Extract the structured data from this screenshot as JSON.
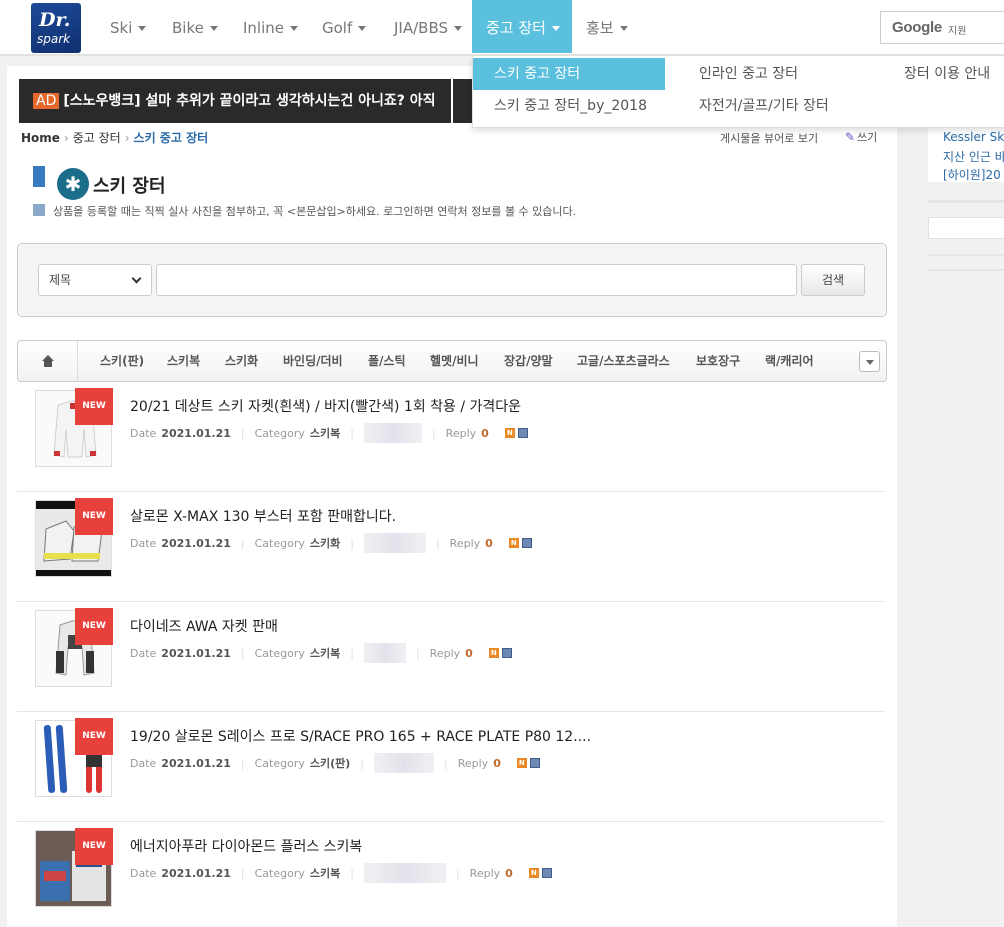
{
  "logo": {
    "line1": "Dr.",
    "line2": "spark"
  },
  "nav": [
    {
      "label": "Ski",
      "active": false
    },
    {
      "label": "Bike",
      "active": false
    },
    {
      "label": "Inline",
      "active": false
    },
    {
      "label": "Golf",
      "active": false
    },
    {
      "label": "JIA/BBS",
      "active": false
    },
    {
      "label": "중고 장터",
      "active": true
    },
    {
      "label": "홍보",
      "active": false
    }
  ],
  "google_search": {
    "brand": "Google",
    "suffix": "지원"
  },
  "dropdown": [
    {
      "label": "스키 중고 장터",
      "active": true
    },
    {
      "label": "인라인 중고 장터"
    },
    {
      "label": "장터 이용 안내"
    },
    {
      "label": "스키 중고 장터_by_2018"
    },
    {
      "label": "자전거/골프/기타 장터"
    }
  ],
  "ad": {
    "tag": "AD",
    "text": "[스노우뱅크] 설마 추위가 끝이라고 생각하시는건 아니죠? 아직"
  },
  "breadcrumb": {
    "home": "Home",
    "parent": "중고 장터",
    "current": "스키 중고 장터"
  },
  "actions": {
    "view_option": "게시물을 뷰어로 보기",
    "write": "쓰기"
  },
  "board": {
    "title": "스키 장터",
    "notice": "상품을 등록할 때는 직찍 실사 사진을 첨부하고, 꼭 <본문삽입>하세요. 로그인하면 연락처 정보를 볼 수 있습니다."
  },
  "search": {
    "select_value": "제목",
    "input_value": "",
    "button": "검색"
  },
  "categories": [
    "스키(판)",
    "스키복",
    "스키화",
    "바인딩/더비",
    "폴/스틱",
    "헬멧/비니",
    "장갑/양말",
    "고글/스포츠글라스",
    "보호장구",
    "랙/캐리어"
  ],
  "labels": {
    "date": "Date",
    "category": "Category",
    "reply": "Reply",
    "new": "NEW",
    "n_icon": "N"
  },
  "items": [
    {
      "title": "20/21 데상트 스키 자켓(흰색) / 바지(빨간색) 1회 착용 / 가격다운",
      "date": "2021.01.21",
      "category": "스키복",
      "reply": "0"
    },
    {
      "title": "살로몬 X-MAX 130 부스터 포함 판매합니다.",
      "date": "2021.01.21",
      "category": "스키화",
      "reply": "0"
    },
    {
      "title": "다이네즈 AWA 자켓 판매",
      "date": "2021.01.21",
      "category": "스키복",
      "reply": "0"
    },
    {
      "title": "19/20 살로몬 S레이스 프로 S/RACE PRO 165 + RACE PLATE P80 12....",
      "date": "2021.01.21",
      "category": "스키(판)",
      "reply": "0"
    },
    {
      "title": "에너지아푸라 다이아몬드 플러스 스키복",
      "date": "2021.01.21",
      "category": "스키복",
      "reply": "0"
    }
  ],
  "sidebar": {
    "line1": "Kessler Ski",
    "line2": "지산 인근 바",
    "line3": "[하이원]20"
  }
}
